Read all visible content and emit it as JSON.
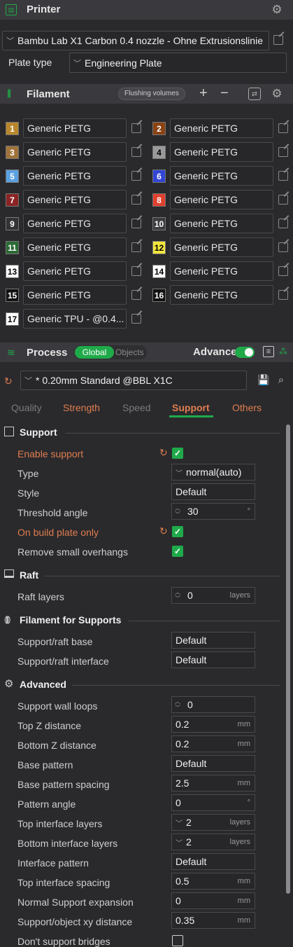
{
  "printer": {
    "title": "Printer",
    "preset": "Bambu Lab X1 Carbon 0.4 nozzle - Ohne Extrusionslinie",
    "plate_label": "Plate type",
    "plate_value": "Engineering Plate"
  },
  "filament": {
    "title": "Filament",
    "flushing_label": "Flushing volumes",
    "add": "+",
    "remove": "−",
    "items": [
      {
        "num": "1",
        "name": "Generic PETG",
        "color": "#b8862c",
        "fg": "#ffffff"
      },
      {
        "num": "2",
        "name": "Generic PETG",
        "color": "#8a4313",
        "fg": "#ffffff"
      },
      {
        "num": "3",
        "name": "Generic PETG",
        "color": "#a0733a",
        "fg": "#ffffff"
      },
      {
        "num": "4",
        "name": "Generic PETG",
        "color": "#9a9a9a",
        "fg": "#000000"
      },
      {
        "num": "5",
        "name": "Generic PETG",
        "color": "#5aa0e0",
        "fg": "#ffffff"
      },
      {
        "num": "6",
        "name": "Generic PETG",
        "color": "#3245d4",
        "fg": "#ffffff"
      },
      {
        "num": "7",
        "name": "Generic PETG",
        "color": "#8a2424",
        "fg": "#ffffff"
      },
      {
        "num": "8",
        "name": "Generic PETG",
        "color": "#e0402e",
        "fg": "#ffffff"
      },
      {
        "num": "9",
        "name": "Generic PETG",
        "color": "#333336",
        "fg": "#ffffff"
      },
      {
        "num": "10",
        "name": "Generic PETG",
        "color": "#3c3c40",
        "fg": "#ffffff"
      },
      {
        "num": "11",
        "name": "Generic PETG",
        "color": "#2a6b34",
        "fg": "#ffffff"
      },
      {
        "num": "12",
        "name": "Generic PETG",
        "color": "#f2e63c",
        "fg": "#000000"
      },
      {
        "num": "13",
        "name": "Generic PETG",
        "color": "#ffffff",
        "fg": "#000000"
      },
      {
        "num": "14",
        "name": "Generic PETG",
        "color": "#ffffff",
        "fg": "#000000"
      },
      {
        "num": "15",
        "name": "Generic PETG",
        "color": "#111111",
        "fg": "#ffffff"
      },
      {
        "num": "16",
        "name": "Generic PETG",
        "color": "#111111",
        "fg": "#ffffff"
      },
      {
        "num": "17",
        "name": "Generic TPU - @0.4...",
        "color": "#ffffff",
        "fg": "#000000"
      }
    ]
  },
  "process": {
    "title": "Process",
    "global": "Global",
    "objects": "Objects",
    "advance": "Advance",
    "preset": "* 0.20mm Standard @BBL X1C"
  },
  "tabs": [
    "Quality",
    "Strength",
    "Speed",
    "Support",
    "Others"
  ],
  "support": {
    "section": "Support",
    "enable_label": "Enable support",
    "type_label": "Type",
    "type_value": "normal(auto)",
    "style_label": "Style",
    "style_value": "Default",
    "threshold_label": "Threshold angle",
    "threshold_value": "30",
    "threshold_unit": "°",
    "build_plate_label": "On build plate only",
    "small_overhangs_label": "Remove small overhangs",
    "raft_section": "Raft",
    "raft_layers_label": "Raft layers",
    "raft_layers_value": "0",
    "raft_layers_unit": "layers",
    "fil_section": "Filament for Supports",
    "base_label": "Support/raft base",
    "base_value": "Default",
    "interface_label": "Support/raft interface",
    "interface_value": "Default",
    "adv_section": "Advanced",
    "wall_loops_label": "Support wall loops",
    "wall_loops_value": "0",
    "top_z_label": "Top Z distance",
    "top_z_value": "0.2",
    "mm": "mm",
    "bottom_z_label": "Bottom Z distance",
    "bottom_z_value": "0.2",
    "base_pattern_label": "Base pattern",
    "base_pattern_value": "Default",
    "base_spacing_label": "Base pattern spacing",
    "base_spacing_value": "2.5",
    "pattern_angle_label": "Pattern angle",
    "pattern_angle_value": "0",
    "deg": "°",
    "top_iface_label": "Top interface layers",
    "top_iface_value": "2",
    "layers": "layers",
    "bottom_iface_label": "Bottom interface layers",
    "bottom_iface_value": "2",
    "iface_pattern_label": "Interface pattern",
    "iface_pattern_value": "Default",
    "top_iface_spacing_label": "Top interface spacing",
    "top_iface_spacing_value": "0.5",
    "normal_exp_label": "Normal Support expansion",
    "normal_exp_value": "0",
    "xy_dist_label": "Support/object xy distance",
    "xy_dist_value": "0.35",
    "bridges_label": "Don't support bridges"
  }
}
